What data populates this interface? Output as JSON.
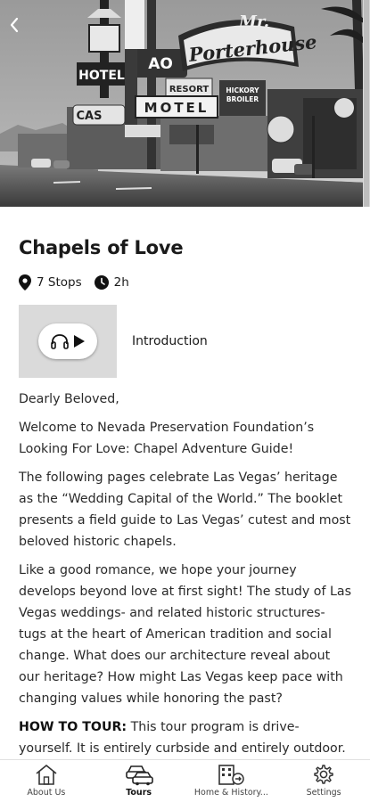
{
  "hero": {
    "signs": {
      "hotel": "HOTEL",
      "resort": "RESORT",
      "motel": "MOTEL",
      "porterhouse_mr": "Mr.",
      "porterhouse": "Porterhouse",
      "hickory": "HICKORY",
      "broiler": "BROILER",
      "cas": "CAS",
      "ao": "AO"
    }
  },
  "tour": {
    "title": "Chapels of Love",
    "stops": "7 Stops",
    "duration": "2h",
    "audio_label": "Introduction"
  },
  "body": {
    "p1": "Dearly Beloved,",
    "p2": "Welcome to Nevada Preservation Foundation’s Looking For Love: Chapel Adventure Guide!",
    "p3": "The following pages celebrate Las Vegas’ heritage as the “Wedding Capital of the World.” The booklet presents a field guide to Las Vegas’ cutest and most beloved historic chapels.",
    "p4": "Like a good romance, we hope your journey develops beyond love at first sight! The study of Las Vegas weddings- and related historic structures- tugs at the heart of American tradition and social change. What does our architecture reveal about our heritage? How might Las Vegas keep pace with changing values while honoring the past?",
    "p5_bold": "HOW TO TOUR:",
    "p5_rest": " This tour program is drive-yourself. It is entirely curbside and entirely outdoor. We"
  },
  "tabs": [
    {
      "label": "About Us",
      "icon": "home-icon",
      "active": false
    },
    {
      "label": "Tours",
      "icon": "cars-icon",
      "active": true
    },
    {
      "label": "Home & History...",
      "icon": "building-icon",
      "active": false
    },
    {
      "label": "Settings",
      "icon": "gear-icon",
      "active": false
    }
  ]
}
